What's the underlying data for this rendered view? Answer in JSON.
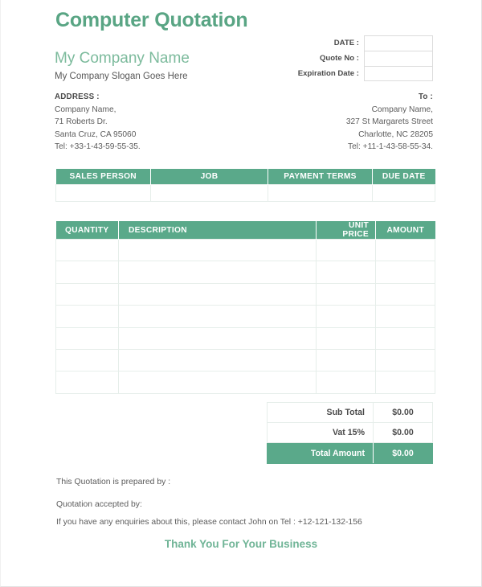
{
  "document": {
    "title": "Computer Quotation",
    "company_name": "My Company Name",
    "company_slogan": "My Company Slogan Goes Here"
  },
  "meta": {
    "rows": [
      {
        "label": "DATE :",
        "value": ""
      },
      {
        "label": "Quote  No :",
        "value": ""
      },
      {
        "label": "Expiration Date :",
        "value": ""
      }
    ]
  },
  "address_from": {
    "heading": "ADDRESS :",
    "line1": "Company Name,",
    "line2": "71 Roberts Dr.",
    "line3": "Santa Cruz, CA 95060",
    "line4": "Tel: +33-1-43-59-55-35."
  },
  "address_to": {
    "heading": "To :",
    "line1": "Company Name,",
    "line2": "327 St Margarets Street",
    "line3": "Charlotte, NC 28205",
    "line4": "Tel: +11-1-43-58-55-34."
  },
  "sales_table": {
    "headers": [
      "SALES PERSON",
      "JOB",
      "PAYMENT TERMS",
      "DUE DATE"
    ],
    "rows": [
      [
        "",
        "",
        "",
        ""
      ]
    ]
  },
  "items_table": {
    "headers": [
      "QUANTITY",
      "DESCRIPTION",
      "UNIT PRICE",
      "AMOUNT"
    ],
    "rows": [
      [
        "",
        "",
        "",
        ""
      ],
      [
        "",
        "",
        "",
        ""
      ],
      [
        "",
        "",
        "",
        ""
      ],
      [
        "",
        "",
        "",
        ""
      ],
      [
        "",
        "",
        "",
        ""
      ],
      [
        "",
        "",
        "",
        ""
      ],
      [
        "",
        "",
        "",
        ""
      ]
    ]
  },
  "totals": {
    "sub_total_label": "Sub Total",
    "sub_total_value": "$0.00",
    "vat_label": "Vat 15%",
    "vat_value": "$0.00",
    "grand_label": "Total Amount",
    "grand_value": "$0.00"
  },
  "footer": {
    "prepared_by": "This Quotation is prepared by :",
    "accepted_by": "Quotation accepted by:",
    "enquiry": "If you have any enquiries about this, please contact John on Tel : +12-121-132-156",
    "thanks": "Thank You For Your Business"
  },
  "colors": {
    "accent": "#5aa98a",
    "title": "#59a584",
    "company": "#7dbb9d",
    "thanks": "#6fb496",
    "grid": "#e6eeea"
  }
}
